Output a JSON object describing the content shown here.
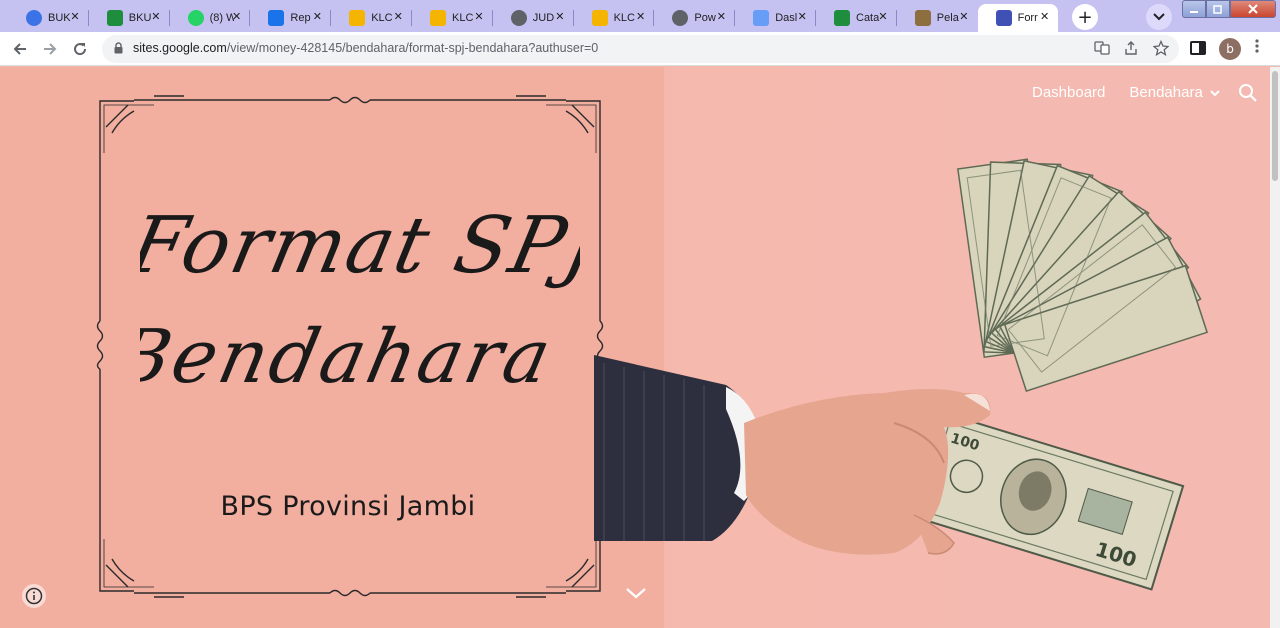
{
  "browser": {
    "tabs": [
      {
        "label": "BUK",
        "icon": "chrome-icon",
        "color": "#3b73e6"
      },
      {
        "label": "BKU",
        "icon": "sheets-icon",
        "color": "#1e8e3e"
      },
      {
        "label": "(8) W",
        "icon": "whatsapp-icon",
        "color": "#25d366"
      },
      {
        "label": "Rep",
        "icon": "script-icon",
        "color": "#1a73e8"
      },
      {
        "label": "KLC",
        "icon": "klc-icon",
        "color": "#f4b400"
      },
      {
        "label": "KLC",
        "icon": "klc-icon",
        "color": "#f4b400"
      },
      {
        "label": "JUD",
        "icon": "globe-icon",
        "color": "#5f6368"
      },
      {
        "label": "KLC",
        "icon": "klc-icon",
        "color": "#f4b400"
      },
      {
        "label": "Pow",
        "icon": "globe-icon",
        "color": "#5f6368"
      },
      {
        "label": "Dasl",
        "icon": "datastudio-icon",
        "color": "#669df6"
      },
      {
        "label": "Cata",
        "icon": "sheets-icon",
        "color": "#1e8e3e"
      },
      {
        "label": "Pela",
        "icon": "emblem-icon",
        "color": "#8d6e3f"
      },
      {
        "label": "Forr",
        "icon": "sites-icon",
        "color": "#3f51b5",
        "active": true
      }
    ],
    "tab_close_glyph": "✕",
    "new_tab_glyph": "+",
    "url_host": "sites.google.com",
    "url_path": "/view/money-428145/bendahara/format-spj-bendahara?authuser=0",
    "profile_initial": "b"
  },
  "site": {
    "nav": {
      "dashboard": "Dashboard",
      "bendahara": "Bendahara"
    },
    "hero": {
      "title_line1": "Format SPJ",
      "title_line2": "Bendahara",
      "subtitle": "BPS Provinsi Jambi"
    },
    "banknote": {
      "denomination": "100"
    }
  },
  "colors": {
    "tabstrip": "#c5c2f1",
    "page_background": "#f4b7ad",
    "frame_ink": "#2a2a2a",
    "nav_text": "#ffffff"
  }
}
